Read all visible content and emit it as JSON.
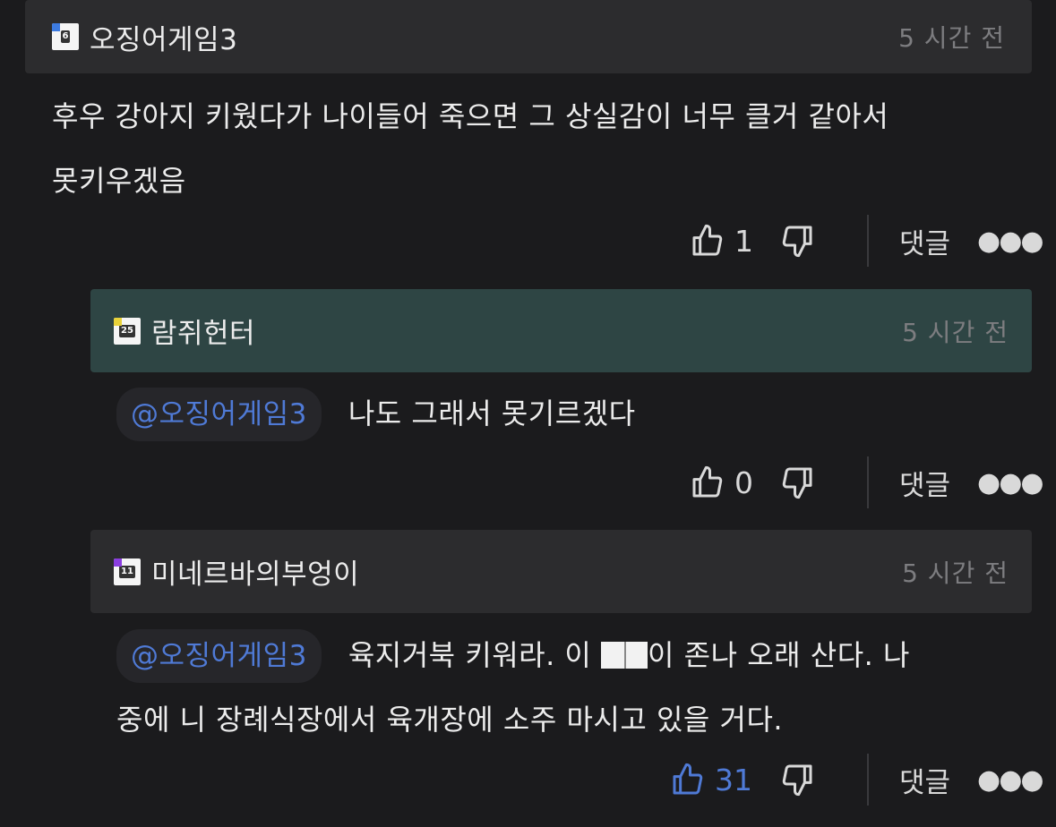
{
  "comments": [
    {
      "username": "오징어게임3",
      "level": "6",
      "timestamp": "5 시간 전",
      "text_lines": [
        "후우 강아지 키웠다가 나이들어 죽으면 그 상실감이 너무 클거 같아서",
        "못키우겠음"
      ],
      "likes": "1",
      "reply_label": "댓글"
    },
    {
      "username": "람쥐헌터",
      "level": "25",
      "timestamp": "5 시간 전",
      "mention": "@오징어게임3",
      "text": "나도 그래서 못기르겠다",
      "likes": "0",
      "reply_label": "댓글"
    },
    {
      "username": "미네르바의부엉이",
      "level": "11",
      "timestamp": "5 시간 전",
      "mention": "@오징어게임3",
      "text_line1_before": "육지거북 키워라. 이 ",
      "text_line1_after": "이 존나 오래 산다. 나",
      "text_line2": "중에 니 장례식장에서 육개장에 소주 마시고 있을 거다.",
      "likes": "31",
      "reply_label": "댓글"
    }
  ],
  "icons": {
    "like": "thumbs-up-icon",
    "dislike": "thumbs-down-icon",
    "more": "more-dots-icon"
  },
  "colors": {
    "background": "#1b1b1d",
    "header": "#2c2c2e",
    "highlight_header": "#2e4544",
    "mention": "#4f7ad6",
    "liked": "#4f7ad6"
  }
}
